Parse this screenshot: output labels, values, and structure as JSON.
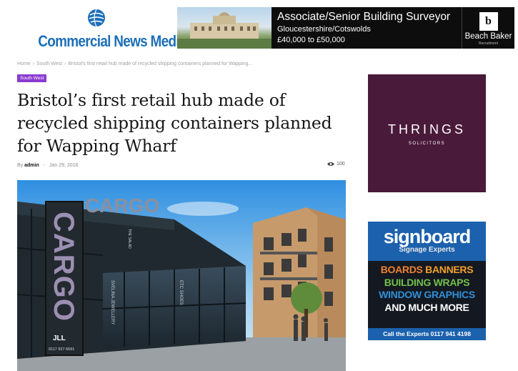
{
  "site": {
    "logo_text": "Commercial News Media",
    "logo_icon": "globe-icon"
  },
  "banner_ad": {
    "title": "Associate/Senior Building Surveyor",
    "location": "Gloucestershire/Cotswolds",
    "salary": "£40,000 to £50,000",
    "brand_name": "Beach Baker",
    "brand_sub": "Recruitment"
  },
  "breadcrumb": {
    "items": [
      "Home",
      "South West",
      "Bristol's first retail hub made of recycled shipping containers planned for Wapping..."
    ],
    "separator": "›"
  },
  "article": {
    "category": "South West",
    "title": "Bristol’s first retail hub made of recycled shipping containers planned for Wapping Wharf",
    "by_label": "By",
    "author": "admin",
    "date": "Jan 29, 2016",
    "views": "100",
    "hero_sign_text": "CARGO",
    "hero_roof_text": "CARGO",
    "hero_sign_brand": "JLL",
    "hero_sign_phone": "0117 927 6691",
    "hero_shop_1": "SVELINA JEWELLERY",
    "hero_shop_2": "ETC SHOES",
    "hero_shop_3": "THE SALAD"
  },
  "sidebar": {
    "ad1": {
      "name": "THRINGS",
      "sub": "SOLICITORS",
      "color": "#4a1a3a"
    },
    "ad2": {
      "name": "signboard",
      "sub": "Signage Experts",
      "line1_a": "BOARDS",
      "line1_b": "BANNERS",
      "line2": "BUILDING WRAPS",
      "line3": "WINDOW GRAPHICS",
      "line4": "AND MUCH MORE",
      "cta": "Call the Experts 0117 941 4198"
    }
  },
  "colors": {
    "logo_blue": "#1d6fb8",
    "category_purple": "#8a3bd0",
    "banner_bg": "#0d0d0d",
    "signboard_blue": "#1b61ad"
  }
}
